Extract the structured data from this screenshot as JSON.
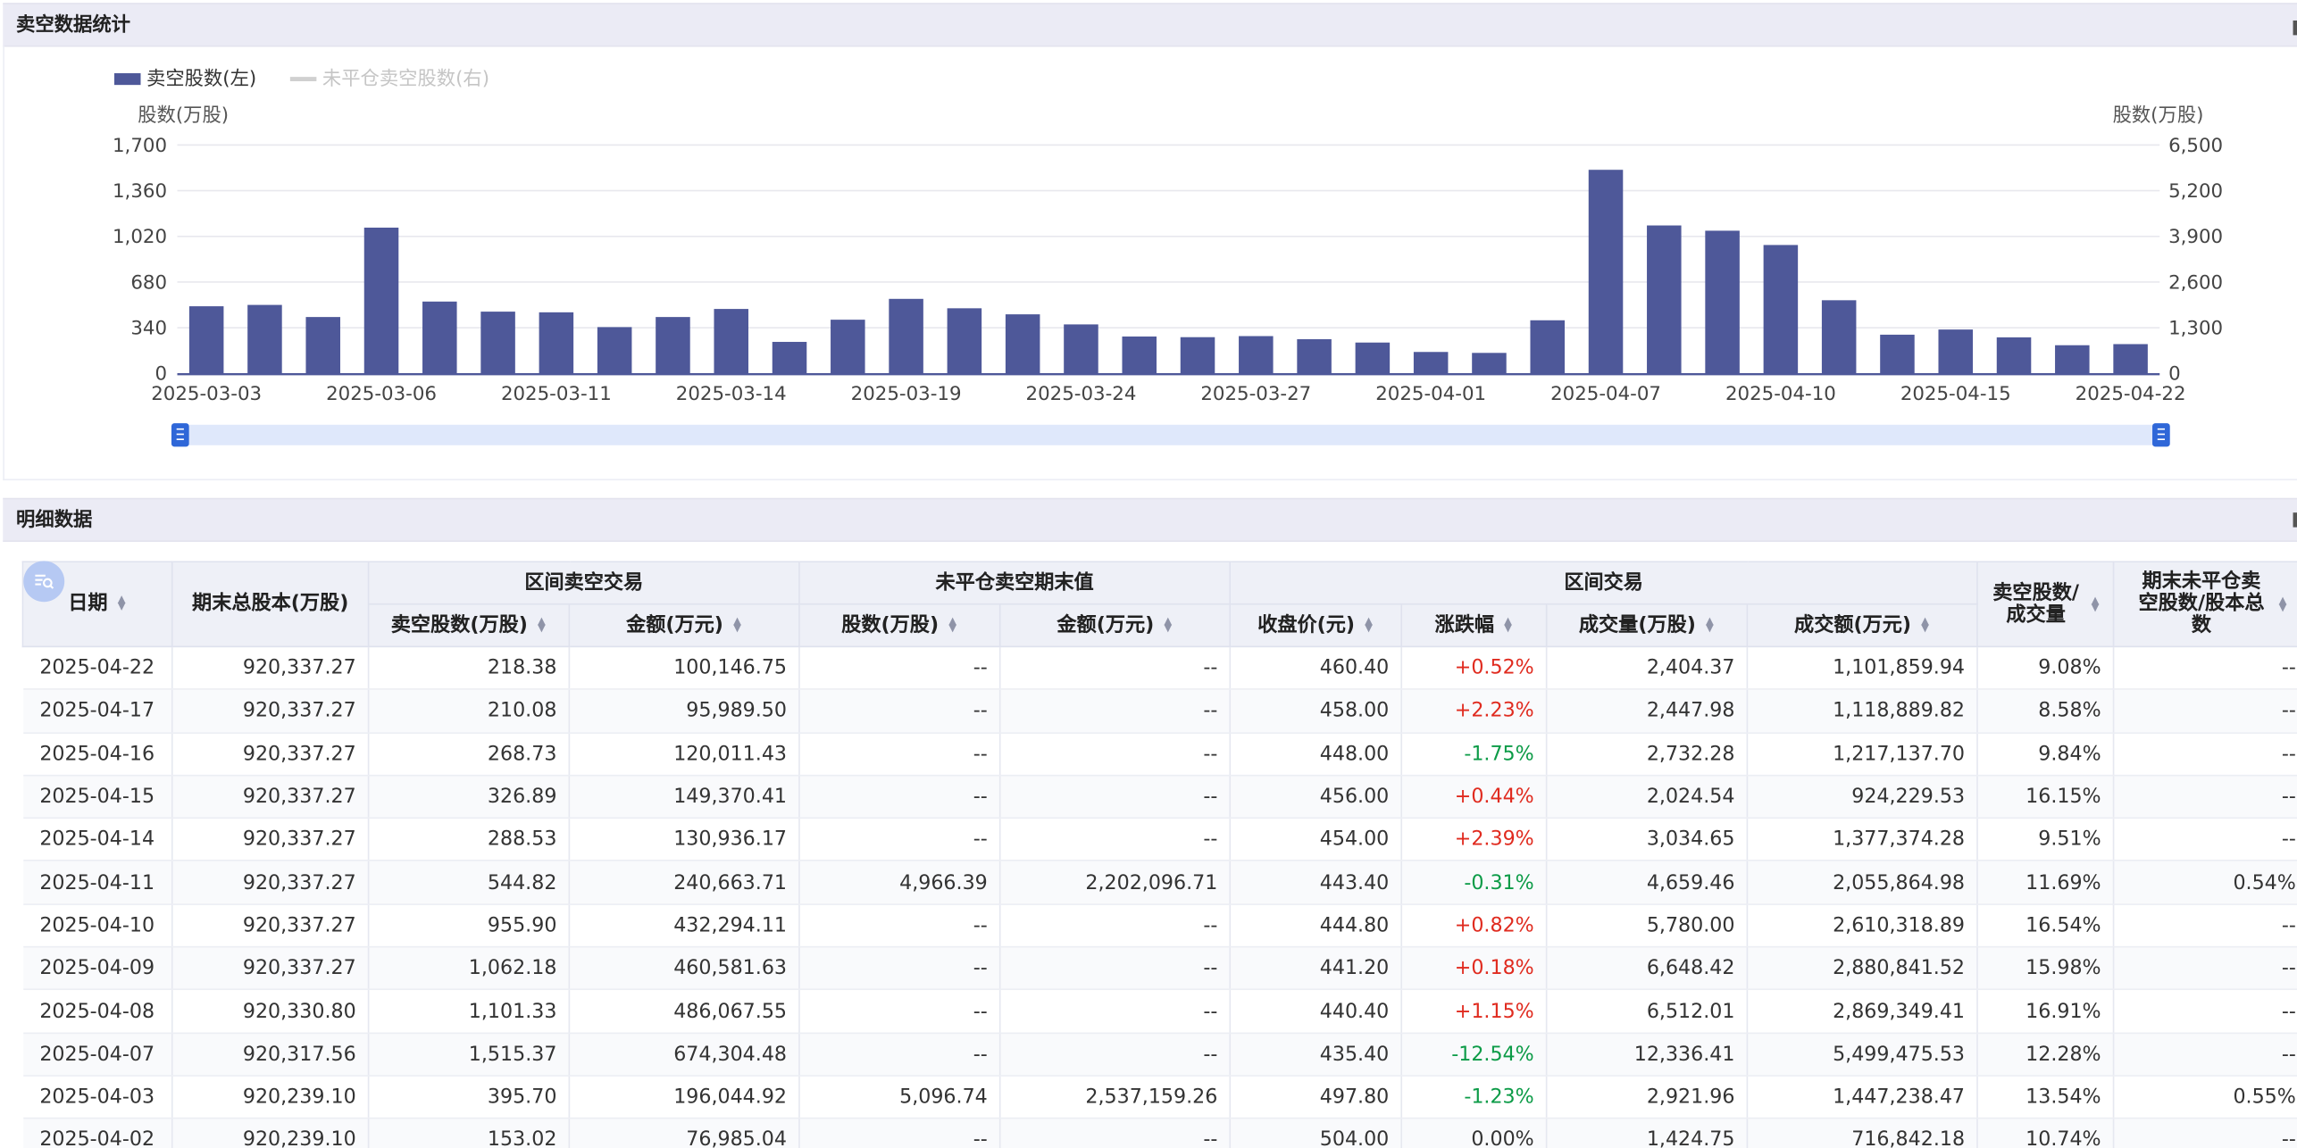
{
  "sections": {
    "stats_title": "卖空数据统计",
    "detail_title": "明细数据"
  },
  "icons": {
    "filter": "filter-search-icon",
    "sort": "sort-icon"
  },
  "colors": {
    "bar": "#4e5899",
    "line": "#d0d0d0",
    "up": "#e02b1f",
    "down": "#0c9b47",
    "slider": "#dfe8fb",
    "handle": "#2f67d8"
  },
  "chart_data": {
    "type": "bar",
    "legend": [
      {
        "name": "卖空股数(左)",
        "active": true
      },
      {
        "name": "未平仓卖空股数(右)",
        "active": false
      }
    ],
    "legend_position": "top-left",
    "y_left_label": "股数(万股)",
    "y_right_label": "股数(万股)",
    "y_left_ticks": [
      "0",
      "340",
      "680",
      "1,020",
      "1,360",
      "1,700"
    ],
    "y_right_ticks": [
      "0",
      "1,300",
      "2,600",
      "3,900",
      "5,200",
      "6,500"
    ],
    "ylim_left": [
      0,
      1700
    ],
    "ylim_right": [
      0,
      6500
    ],
    "grid": true,
    "x_tick_labels": [
      "2025-03-03",
      "2025-03-06",
      "2025-03-11",
      "2025-03-14",
      "2025-03-19",
      "2025-03-24",
      "2025-03-27",
      "2025-04-01",
      "2025-04-07",
      "2025-04-10",
      "2025-04-15",
      "2025-04-22"
    ],
    "categories": [
      "2025-03-03",
      "2025-03-04",
      "2025-03-05",
      "2025-03-06",
      "2025-03-07",
      "2025-03-10",
      "2025-03-11",
      "2025-03-12",
      "2025-03-13",
      "2025-03-14",
      "2025-03-17",
      "2025-03-18",
      "2025-03-19",
      "2025-03-20",
      "2025-03-21",
      "2025-03-24",
      "2025-03-25",
      "2025-03-26",
      "2025-03-27",
      "2025-03-28",
      "2025-03-31",
      "2025-04-01",
      "2025-04-02",
      "2025-04-03",
      "2025-04-07",
      "2025-04-08",
      "2025-04-09",
      "2025-04-10",
      "2025-04-11",
      "2025-04-14",
      "2025-04-15",
      "2025-04-16",
      "2025-04-17",
      "2025-04-22"
    ],
    "series": [
      {
        "name": "卖空股数(左)",
        "axis": "left",
        "values": [
          500,
          510,
          420,
          1085,
          535,
          460,
          455,
          345,
          420,
          480,
          235,
          400,
          555,
          485,
          440,
          365,
          275,
          270,
          278,
          255,
          230,
          160,
          153,
          395.7,
          1515.37,
          1101.33,
          1062.18,
          955.9,
          544.82,
          288.53,
          326.89,
          268.73,
          210.08,
          218.38
        ]
      }
    ]
  },
  "table": {
    "group_headers": {
      "interval_short": "区间卖空交易",
      "open_short": "未平仓卖空期末值",
      "interval_trade": "区间交易"
    },
    "headers": {
      "date": "日期",
      "total_shares": "期末总股本(万股)",
      "short_shares": "卖空股数(万股)",
      "short_amount": "金额(万元)",
      "open_shares": "股数(万股)",
      "open_amount": "金额(万元)",
      "close": "收盘价(元)",
      "change": "涨跌幅",
      "volume": "成交量(万股)",
      "turnover": "成交额(万元)",
      "short_ratio": "卖空股数/成交量",
      "open_ratio": "期末未平仓卖空股数/股本总数"
    },
    "rows": [
      {
        "date": "2025-04-22",
        "total": "920,337.27",
        "short": "218.38",
        "amount": "100,146.75",
        "open_sh": "--",
        "open_amt": "--",
        "close": "460.40",
        "change": "+0.52%",
        "dir": "up",
        "volume": "2,404.37",
        "turnover": "1,101,859.94",
        "ratio": "9.08%",
        "open_ratio": "--"
      },
      {
        "date": "2025-04-17",
        "total": "920,337.27",
        "short": "210.08",
        "amount": "95,989.50",
        "open_sh": "--",
        "open_amt": "--",
        "close": "458.00",
        "change": "+2.23%",
        "dir": "up",
        "volume": "2,447.98",
        "turnover": "1,118,889.82",
        "ratio": "8.58%",
        "open_ratio": "--"
      },
      {
        "date": "2025-04-16",
        "total": "920,337.27",
        "short": "268.73",
        "amount": "120,011.43",
        "open_sh": "--",
        "open_amt": "--",
        "close": "448.00",
        "change": "-1.75%",
        "dir": "down",
        "volume": "2,732.28",
        "turnover": "1,217,137.70",
        "ratio": "9.84%",
        "open_ratio": "--"
      },
      {
        "date": "2025-04-15",
        "total": "920,337.27",
        "short": "326.89",
        "amount": "149,370.41",
        "open_sh": "--",
        "open_amt": "--",
        "close": "456.00",
        "change": "+0.44%",
        "dir": "up",
        "volume": "2,024.54",
        "turnover": "924,229.53",
        "ratio": "16.15%",
        "open_ratio": "--"
      },
      {
        "date": "2025-04-14",
        "total": "920,337.27",
        "short": "288.53",
        "amount": "130,936.17",
        "open_sh": "--",
        "open_amt": "--",
        "close": "454.00",
        "change": "+2.39%",
        "dir": "up",
        "volume": "3,034.65",
        "turnover": "1,377,374.28",
        "ratio": "9.51%",
        "open_ratio": "--"
      },
      {
        "date": "2025-04-11",
        "total": "920,337.27",
        "short": "544.82",
        "amount": "240,663.71",
        "open_sh": "4,966.39",
        "open_amt": "2,202,096.71",
        "close": "443.40",
        "change": "-0.31%",
        "dir": "down",
        "volume": "4,659.46",
        "turnover": "2,055,864.98",
        "ratio": "11.69%",
        "open_ratio": "0.54%"
      },
      {
        "date": "2025-04-10",
        "total": "920,337.27",
        "short": "955.90",
        "amount": "432,294.11",
        "open_sh": "--",
        "open_amt": "--",
        "close": "444.80",
        "change": "+0.82%",
        "dir": "up",
        "volume": "5,780.00",
        "turnover": "2,610,318.89",
        "ratio": "16.54%",
        "open_ratio": "--"
      },
      {
        "date": "2025-04-09",
        "total": "920,337.27",
        "short": "1,062.18",
        "amount": "460,581.63",
        "open_sh": "--",
        "open_amt": "--",
        "close": "441.20",
        "change": "+0.18%",
        "dir": "up",
        "volume": "6,648.42",
        "turnover": "2,880,841.52",
        "ratio": "15.98%",
        "open_ratio": "--"
      },
      {
        "date": "2025-04-08",
        "total": "920,330.80",
        "short": "1,101.33",
        "amount": "486,067.55",
        "open_sh": "--",
        "open_amt": "--",
        "close": "440.40",
        "change": "+1.15%",
        "dir": "up",
        "volume": "6,512.01",
        "turnover": "2,869,349.41",
        "ratio": "16.91%",
        "open_ratio": "--"
      },
      {
        "date": "2025-04-07",
        "total": "920,317.56",
        "short": "1,515.37",
        "amount": "674,304.48",
        "open_sh": "--",
        "open_amt": "--",
        "close": "435.40",
        "change": "-12.54%",
        "dir": "down",
        "volume": "12,336.41",
        "turnover": "5,499,475.53",
        "ratio": "12.28%",
        "open_ratio": "--"
      },
      {
        "date": "2025-04-03",
        "total": "920,239.10",
        "short": "395.70",
        "amount": "196,044.92",
        "open_sh": "5,096.74",
        "open_amt": "2,537,159.26",
        "close": "497.80",
        "change": "-1.23%",
        "dir": "down",
        "volume": "2,921.96",
        "turnover": "1,447,238.47",
        "ratio": "13.54%",
        "open_ratio": "0.55%"
      },
      {
        "date": "2025-04-02",
        "total": "920,239.10",
        "short": "153.02",
        "amount": "76,985.04",
        "open_sh": "--",
        "open_amt": "--",
        "close": "504.00",
        "change": "0.00%",
        "dir": "flat",
        "volume": "1,424.75",
        "turnover": "716,842.18",
        "ratio": "10.74%",
        "open_ratio": "--"
      }
    ]
  }
}
